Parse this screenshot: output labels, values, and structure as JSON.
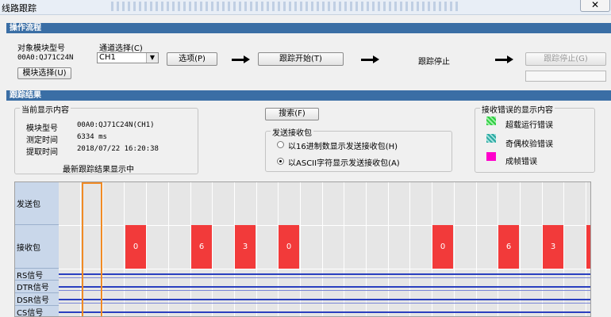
{
  "window": {
    "title": "线路跟踪",
    "close_symbol": "✕"
  },
  "procedure": {
    "header": "操作流程",
    "model_label": "对象模块型号",
    "model_value": "00A0:QJ71C24N",
    "module_select_button": "模块选择(U)",
    "channel_label": "通道选择(C)",
    "channel_value": "CH1",
    "options_button": "选项(P)",
    "trace_start_button": "跟踪开始(T)",
    "trace_stop_text": "跟踪停止",
    "trace_stop_button": "跟踪停止(G)"
  },
  "result": {
    "header": "跟踪结果",
    "current": {
      "title": "当前显示内容",
      "rows": [
        {
          "label": "模块型号",
          "value": "00A0:QJ71C24N(CH1)"
        },
        {
          "label": "测定时间",
          "value": "6334 ms"
        },
        {
          "label": "提取时间",
          "value": "2018/07/22 16:20:38"
        }
      ],
      "status": "最新跟踪结果显示中"
    },
    "search_button": "搜索(F)",
    "send_receive": {
      "title": "发送接收包",
      "options": [
        {
          "label": "以16进制数显示发送接收包(H)",
          "selected": false
        },
        {
          "label": "以ASCII字符显示发送接收包(A)",
          "selected": true
        }
      ]
    },
    "error_legend": {
      "title": "接收错误的显示内容",
      "items": [
        {
          "label": "超载运行错误",
          "color": "#2ecc40"
        },
        {
          "label": "奇偶校验错误",
          "color": "#2aa8a0"
        },
        {
          "label": "成帧错误",
          "color": "#ff00cc"
        }
      ]
    }
  },
  "trace_chart": {
    "rows": [
      "发送包",
      "接收包",
      "RS信号",
      "DTR信号",
      "DSR信号",
      "CS信号"
    ],
    "received_blocks": [
      "0",
      "6",
      "3",
      "0",
      "0",
      "6",
      "3",
      ""
    ],
    "colors": {
      "rx_block": "#f23a3a",
      "cursor": "#f08a24",
      "signal": "#2a3fbf",
      "row_header": "#c9d7ea"
    }
  }
}
